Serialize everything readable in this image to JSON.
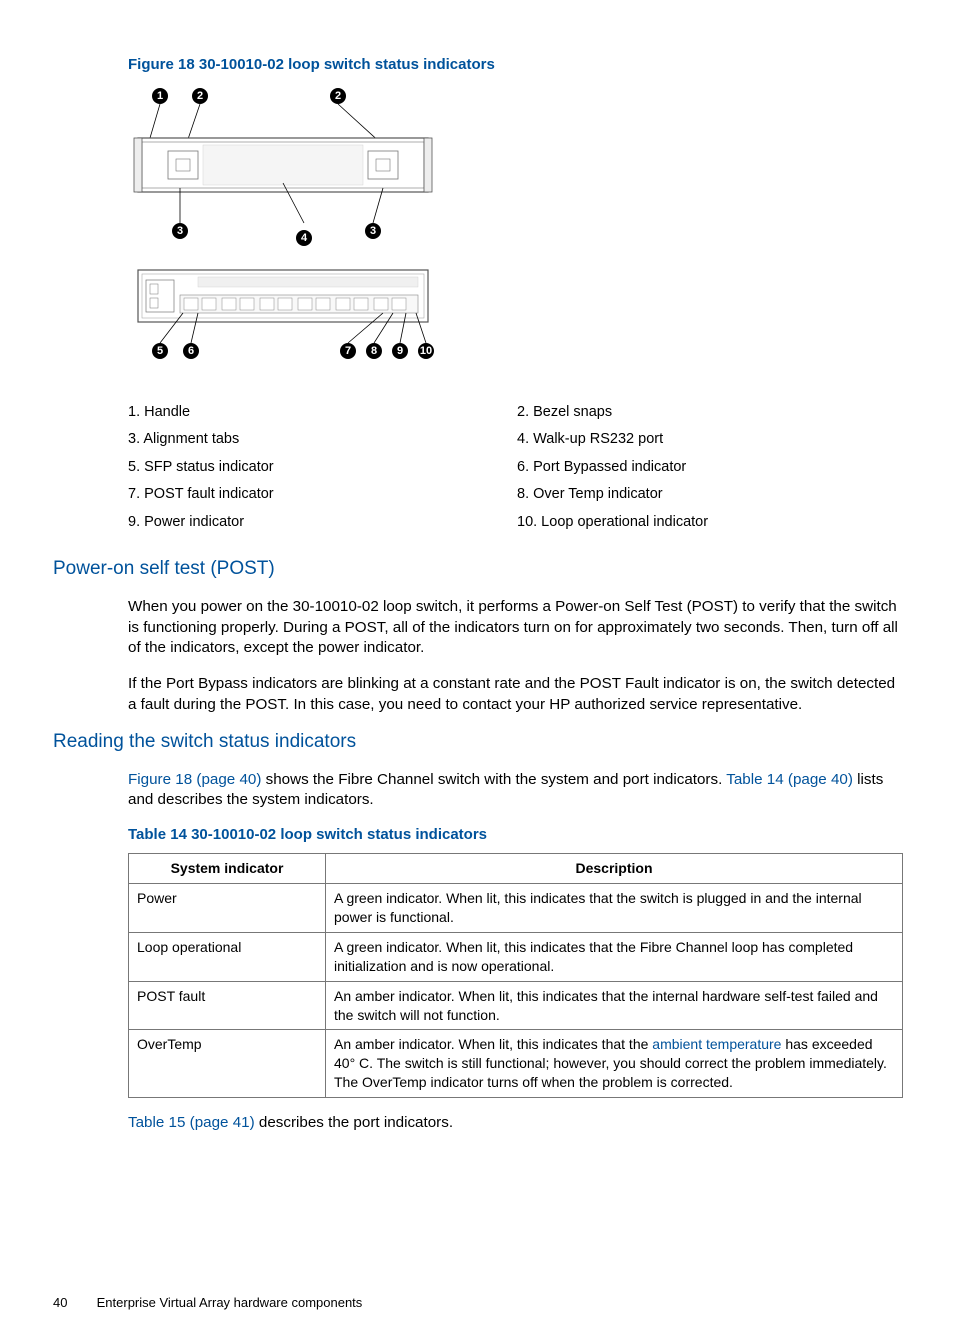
{
  "figure_caption": "Figure 18 30-10010-02 loop switch status indicators",
  "legend": {
    "l1": "1. Handle",
    "l2": "2. Bezel snaps",
    "l3": "3. Alignment tabs",
    "l4": "4. Walk-up RS232 port",
    "l5": "5. SFP status indicator",
    "l6": "6. Port Bypassed indicator",
    "l7": "7. POST fault indicator",
    "l8": "8. Over Temp indicator",
    "l9": "9. Power indicator",
    "l10": "10. Loop operational indicator"
  },
  "sections": {
    "post": {
      "heading": "Power-on self test (POST)",
      "p1": "When you power on the 30-10010-02 loop switch, it performs a Power-on Self Test (POST) to verify that the switch is functioning properly. During a POST, all of the indicators turn on for approximately two seconds. Then, turn off all of the indicators, except the power indicator.",
      "p2": "If the Port Bypass indicators are blinking at a constant rate and the POST Fault indicator is on, the switch detected a fault during the POST. In this case, you need to contact your HP authorized service representative."
    },
    "reading": {
      "heading": "Reading the switch status indicators",
      "link1": "Figure 18 (page 40)",
      "tail1": " shows the Fibre Channel switch with the system and port indicators. ",
      "link2": "Table 14 (page 40)",
      "tail2": " lists and describes the system indicators."
    }
  },
  "table": {
    "caption": "Table 14 30-10010-02 loop switch status indicators",
    "headers": {
      "c1": "System indicator",
      "c2": "Description"
    },
    "rows": [
      {
        "c1": "Power",
        "c2": "A green indicator. When lit, this indicates that the switch is plugged in and the internal power is functional."
      },
      {
        "c1": "Loop operational",
        "c2": "A green indicator. When lit, this indicates that the Fibre Channel loop has completed initialization and is now operational."
      },
      {
        "c1": "POST fault",
        "c2": "An amber indicator. When lit, this indicates that the internal hardware self-test failed and the switch will not function."
      },
      {
        "c1": "OverTemp",
        "c2_pre": "An amber indicator. When lit, this indicates that the ",
        "c2_link": "ambient temperature",
        "c2_post": " has exceeded 40° C. The switch is still functional; however, you should correct the problem immediately. The OverTemp indicator turns off when the problem is corrected."
      }
    ]
  },
  "after_table": {
    "link": "Table 15 (page 41)",
    "tail": " describes the port indicators."
  },
  "footer": {
    "page": "40",
    "title": "Enterprise Virtual Array hardware components"
  }
}
